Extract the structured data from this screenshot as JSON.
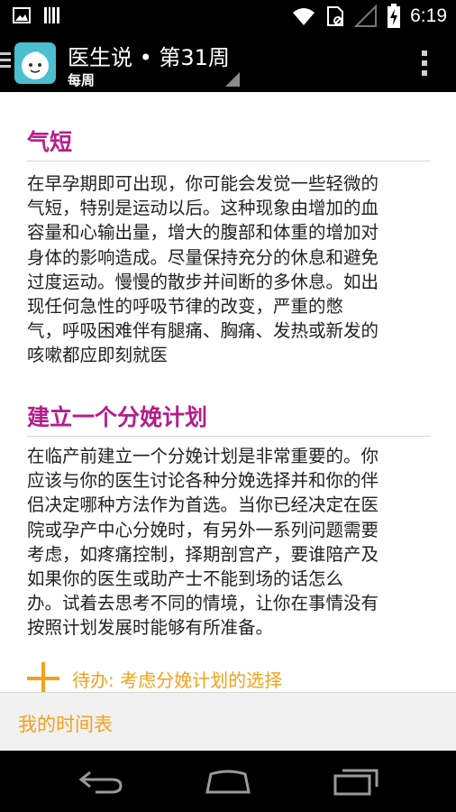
{
  "status_bar": {
    "time": "6:19",
    "icons": [
      "image-icon",
      "barcode-icon",
      "wifi-icon",
      "no-sim-icon",
      "signal-icon",
      "battery-charging-icon"
    ]
  },
  "action_bar": {
    "title": "医生说 • 第31周",
    "subtitle": "每周",
    "icons": [
      "drawer-icon",
      "baby-face-icon",
      "spinner-corner-icon",
      "overflow-menu-icon"
    ]
  },
  "sections": [
    {
      "title": "气短",
      "lines": [
        "在早孕期即可出现，你可能会发觉一些轻微的",
        "气短，特别是运动以后。这种现象由增加的血",
        "容量和心输出量，增大的腹部和体重的增加对",
        "身体的影响造成。尽量保持充分的休息和避免",
        "过度运动。慢慢的散步并间断的多休息。如出",
        "现任何急性的呼吸节律的改变，严重的憋",
        "气，呼吸困难伴有腿痛、胸痛、发热或新发的",
        "咳嗽都应即刻就医"
      ]
    },
    {
      "title": "建立一个分娩计划",
      "lines": [
        "在临产前建立一个分娩计划是非常重要的。你",
        "应该与你的医生讨论各种分娩选择并和你的伴",
        "侣决定哪种方法作为首选。当你已经决定在医",
        "院或孕产中心分娩时，有另外一系列问题需要",
        "考虑，如疼痛控制，择期剖宫产，要谁陪产及",
        "如果你的医生或助产士不能到场的话怎么",
        "办。试着去思考不同的情境，让你在事情没有",
        "按照计划发展时能够有所准备。"
      ]
    }
  ],
  "todo": {
    "label": "待办: 考虑分娩计划的选择",
    "icon": "plus-icon",
    "color": "#f5a11a"
  },
  "bottom_tab": {
    "label": "我的时间表"
  },
  "nav_bar": {
    "icons": [
      "back-icon",
      "home-icon",
      "recent-apps-icon"
    ]
  },
  "colors": {
    "section_title": "#b51e8a",
    "accent": "#f5a11a",
    "app_icon_bg": "#4bbfcf"
  }
}
